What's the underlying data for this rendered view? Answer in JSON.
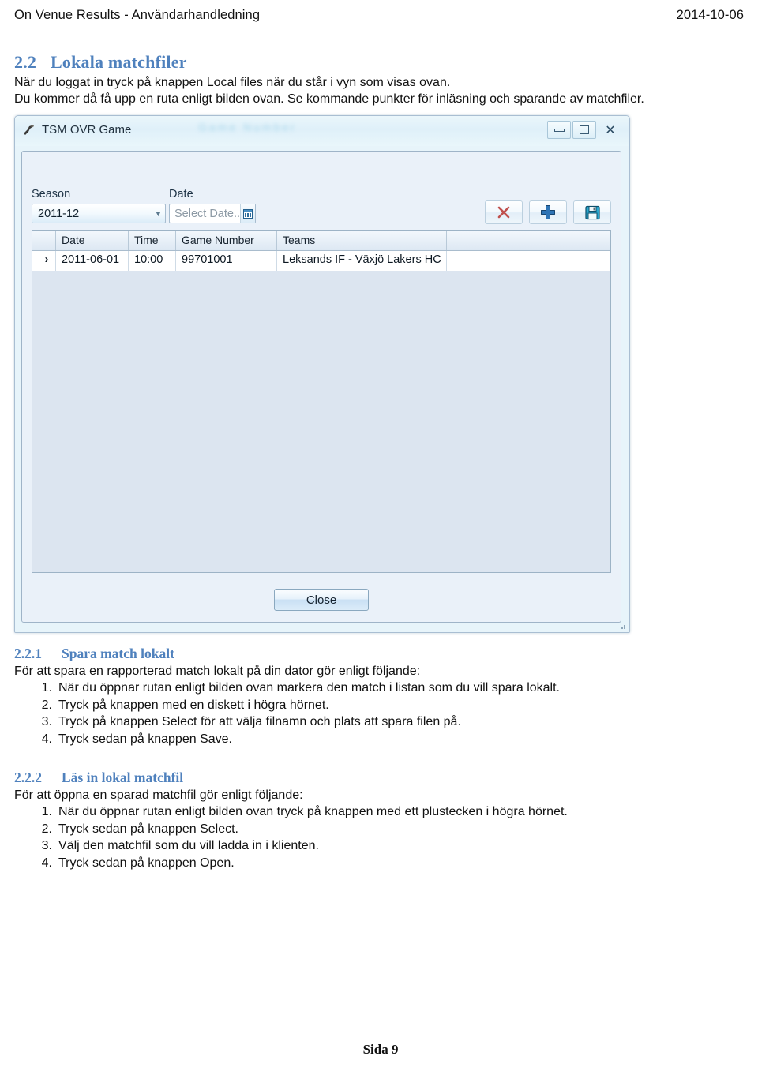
{
  "header": {
    "title": "On Venue Results - Användarhandledning",
    "date": "2014-10-06"
  },
  "section": {
    "number": "2.2",
    "title": "Lokala matchfiler",
    "paragraphs": [
      "När du loggat in tryck på knappen Local files när du står i vyn som visas ovan.",
      "Du kommer då få upp en ruta enligt bilden ovan. Se kommande punkter för inläsning och sparande av matchfiler."
    ]
  },
  "app_window": {
    "title": "TSM OVR Game",
    "app_icon": "app-icon",
    "ghost_text": "Game Number",
    "window_buttons": {
      "minimize": "minimize-button",
      "maximize": "maximize-button",
      "close": "✕"
    },
    "toolbar": {
      "season_label": "Season",
      "season_value": "2011-12",
      "date_label": "Date",
      "date_placeholder": "Select Date..",
      "calendar_icon": "calendar-icon",
      "delete_icon": "red-x-icon",
      "add_icon": "blue-plus-icon",
      "save_icon": "floppy-disk-icon"
    },
    "grid": {
      "columns": [
        "Date",
        "Time",
        "Game Number",
        "Teams"
      ],
      "row_marker": "›",
      "rows": [
        {
          "date": "2011-06-01",
          "time": "10:00",
          "game_number": "99701001",
          "teams": "Leksands IF - Växjö Lakers HC"
        }
      ]
    },
    "close_button": "Close"
  },
  "subsection_221": {
    "number": "2.2.1",
    "title": "Spara match lokalt",
    "intro": "För att spara en rapporterad match lokalt på din dator gör enligt följande:",
    "steps": [
      "När du öppnar rutan enligt bilden ovan markera den match i listan som du vill spara lokalt.",
      "Tryck på knappen med en diskett i högra hörnet.",
      "Tryck på knappen Select för att välja filnamn och plats att spara filen på.",
      "Tryck sedan på knappen Save."
    ]
  },
  "subsection_222": {
    "number": "2.2.2",
    "title": "Läs in lokal matchfil",
    "intro": "För att öppna en sparad matchfil gör enligt följande:",
    "steps": [
      "När du öppnar rutan enligt bilden ovan tryck på knappen med ett plustecken i högra hörnet.",
      "Tryck sedan på knappen Select.",
      "Välj den matchfil som du vill ladda in i klienten.",
      "Tryck sedan på knappen Open."
    ]
  },
  "footer": {
    "page_label": "Sida 9"
  },
  "colors": {
    "heading": "#4f81bd",
    "footer_rule": "#5b7c96",
    "accent_blue": "#1f6fb5",
    "delete_red": "#c0504d"
  }
}
